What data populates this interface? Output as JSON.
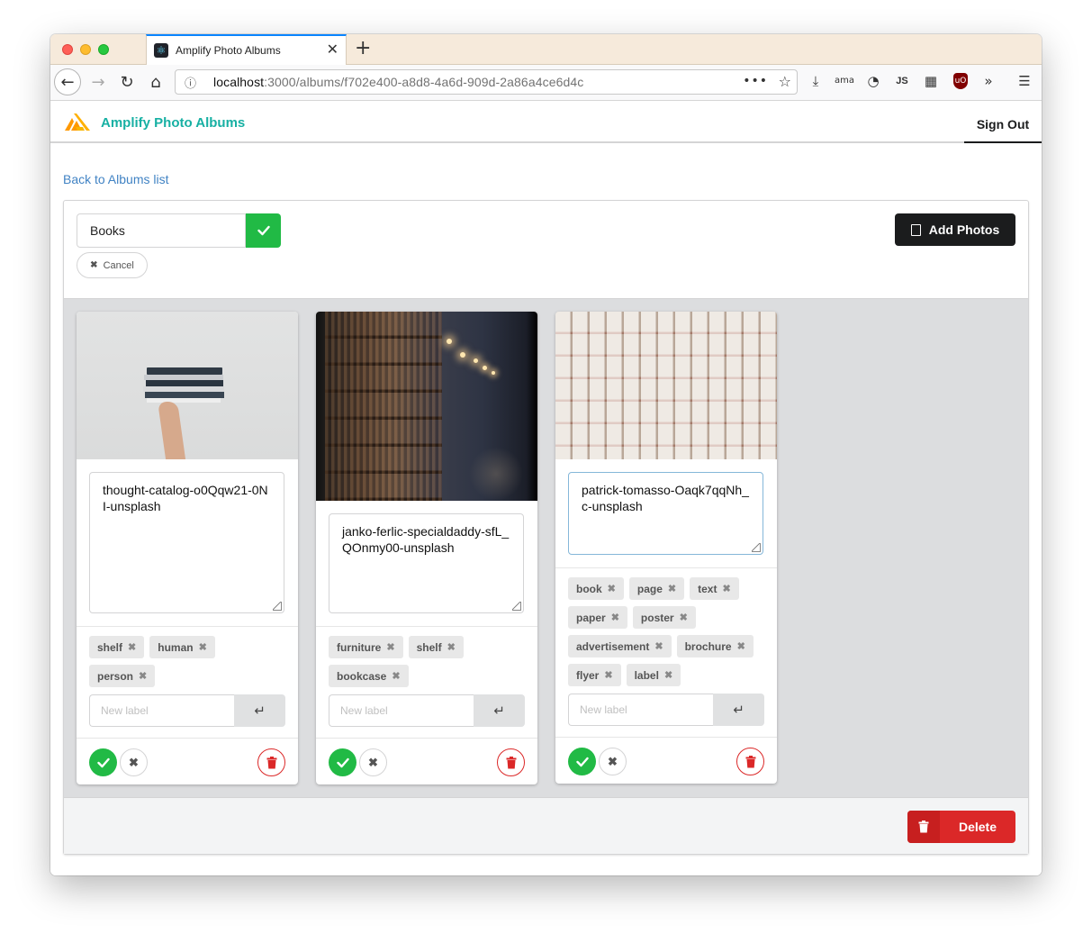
{
  "browser": {
    "tab_title": "Amplify Photo Albums",
    "url_host": "localhost",
    "url_path": ":3000/albums/f702e400-a8d8-4a6d-909d-2a86a4ce6d4c",
    "extensions": [
      "download-icon",
      "amazon-icon",
      "password-icon",
      "JS",
      "grid-icon",
      "ublock-icon",
      "overflow-icon",
      "menu-icon"
    ],
    "js_label": "JS"
  },
  "app": {
    "title": "Amplify Photo Albums",
    "sign_out": "Sign Out",
    "back_link": "Back to Albums list"
  },
  "album": {
    "name": "Books",
    "cancel_label": "Cancel",
    "add_photos_label": "Add Photos",
    "delete_label": "Delete"
  },
  "photos": [
    {
      "description": "thought-catalog-o0Qqw21-0NI-unsplash",
      "labels": [
        "shelf",
        "human",
        "person"
      ],
      "new_label_placeholder": "New label"
    },
    {
      "description": "janko-ferlic-specialdaddy-sfL_QOnmy00-unsplash",
      "labels": [
        "furniture",
        "shelf",
        "bookcase"
      ],
      "new_label_placeholder": "New label"
    },
    {
      "description": "patrick-tomasso-Oaqk7qqNh_c-unsplash",
      "labels": [
        "book",
        "page",
        "text",
        "paper",
        "poster",
        "advertisement",
        "brochure",
        "flyer",
        "label"
      ],
      "new_label_placeholder": "New label"
    }
  ],
  "colors": {
    "accent_teal": "#17b0a3",
    "success": "#21ba45",
    "danger": "#db2828",
    "link": "#4183c4"
  }
}
